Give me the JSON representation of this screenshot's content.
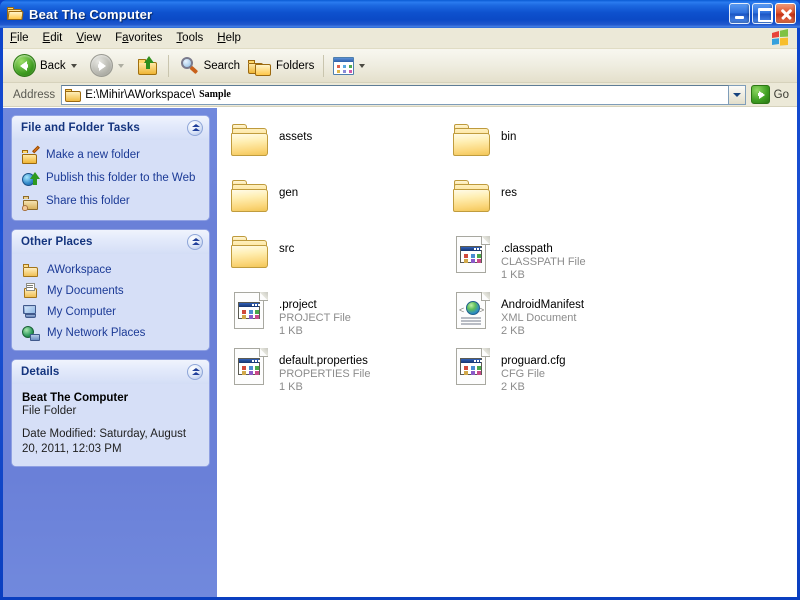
{
  "window": {
    "title": "Beat The Computer",
    "icon": "folder-icon",
    "buttons": {
      "minimize": "minimize",
      "maximize": "maximize",
      "close": "close"
    }
  },
  "menubar": {
    "items": [
      {
        "label": "File",
        "accel": "F"
      },
      {
        "label": "Edit",
        "accel": "E"
      },
      {
        "label": "View",
        "accel": "V"
      },
      {
        "label": "Favorites",
        "accel": "a"
      },
      {
        "label": "Tools",
        "accel": "T"
      },
      {
        "label": "Help",
        "accel": "H"
      }
    ],
    "brand_icon": "windows-flag-icon"
  },
  "toolbar": {
    "back_label": "Back",
    "forward_label": "",
    "up_label": "",
    "search_label": "Search",
    "folders_label": "Folders",
    "views_label": ""
  },
  "address": {
    "label": "Address",
    "path": "E:\\Mihir\\AWorkspace\\",
    "extra": "Sample",
    "go_label": "Go"
  },
  "sidebar": {
    "panels": [
      {
        "title": "File and Folder Tasks",
        "type": "tasks",
        "items": [
          {
            "label": "Make a new folder",
            "icon": "new-folder-icon"
          },
          {
            "label": "Publish this folder to the Web",
            "icon": "publish-web-icon"
          },
          {
            "label": "Share this folder",
            "icon": "share-folder-icon"
          }
        ]
      },
      {
        "title": "Other Places",
        "type": "places",
        "items": [
          {
            "label": "AWorkspace",
            "icon": "folder-icon"
          },
          {
            "label": "My Documents",
            "icon": "my-documents-icon"
          },
          {
            "label": "My Computer",
            "icon": "my-computer-icon"
          },
          {
            "label": "My Network Places",
            "icon": "network-places-icon"
          }
        ]
      },
      {
        "title": "Details",
        "type": "details",
        "name": "Beat The Computer",
        "kind": "File Folder",
        "date_modified": "Date Modified: Saturday, August 20, 2011, 12:03 PM"
      }
    ]
  },
  "filelist": {
    "items": [
      {
        "name": "assets",
        "type": "",
        "size": "",
        "icon": "folder-icon"
      },
      {
        "name": "bin",
        "type": "",
        "size": "",
        "icon": "folder-icon"
      },
      {
        "name": "gen",
        "type": "",
        "size": "",
        "icon": "folder-icon"
      },
      {
        "name": "res",
        "type": "",
        "size": "",
        "icon": "folder-icon"
      },
      {
        "name": "src",
        "type": "",
        "size": "",
        "icon": "folder-icon"
      },
      {
        "name": ".classpath",
        "type": "CLASSPATH File",
        "size": "1 KB",
        "icon": "generic-file-icon"
      },
      {
        "name": ".project",
        "type": "PROJECT File",
        "size": "1 KB",
        "icon": "generic-file-icon"
      },
      {
        "name": "AndroidManifest",
        "type": "XML Document",
        "size": "2 KB",
        "icon": "xml-document-icon"
      },
      {
        "name": "default.properties",
        "type": "PROPERTIES File",
        "size": "1 KB",
        "icon": "generic-file-icon"
      },
      {
        "name": "proguard.cfg",
        "type": "CFG File",
        "size": "2 KB",
        "icon": "generic-file-icon"
      }
    ]
  },
  "colors": {
    "titlebar_blue": "#0A51CE",
    "window_border": "#0A41C8",
    "sidebar_blue": "#6A80D8",
    "panel_body": "#D6DFF7",
    "panel_title_text": "#14347E",
    "link_text": "#1B3A96",
    "toolbar_face": "#ECE9D8",
    "file_sub_text": "#8C8C8C",
    "folder_yellow": "#F3C65C"
  }
}
